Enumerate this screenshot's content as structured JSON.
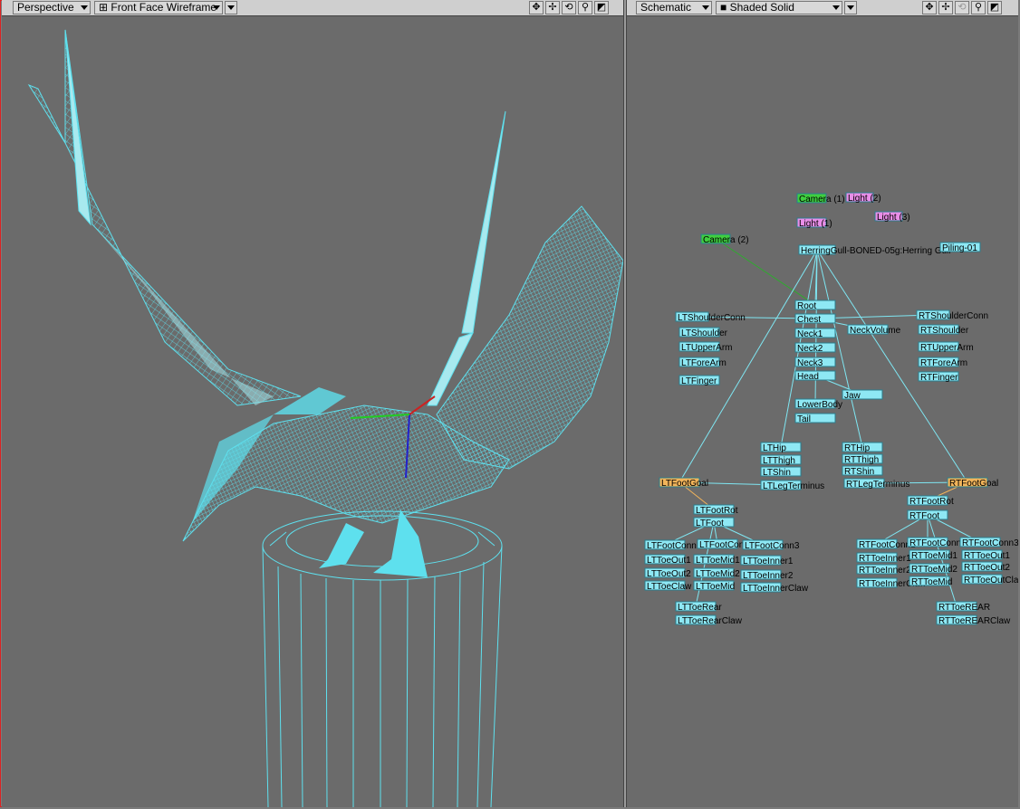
{
  "left_viewport": {
    "view_type": "Perspective",
    "render_mode": "Front Face Wireframe",
    "icons": [
      "move-view-icon",
      "rotate-view-icon",
      "zoom-view-icon",
      "maximize-view-icon"
    ]
  },
  "right_viewport": {
    "view_type": "Schematic",
    "render_mode": "Shaded Solid",
    "icons": [
      "move-view-icon",
      "rotate-view-icon",
      "zoom-view-icon",
      "maximize-view-icon"
    ]
  },
  "colors": {
    "wireframe": "#5ee0ee",
    "bone_node": "#8ee8f4",
    "camera_node": "#3fcf3f",
    "light_node": "#e88ee8",
    "goal_node": "#f2b45a",
    "link": "#7fe6f2",
    "background": "#6b6b6b"
  },
  "schematic": {
    "cameras": [
      "Camera (1)",
      "Camera (2)"
    ],
    "lights": [
      "Light (1)",
      "Light (2)",
      "Light (3)"
    ],
    "objects": [
      "HerringGull-BONED-05g:Herring Gull",
      "Piling-01"
    ],
    "bones_center": [
      "Root",
      "Chest",
      "Neck1",
      "Neck2",
      "Neck3",
      "Head",
      "Jaw",
      "NeckVolume",
      "LowerBody",
      "Tail"
    ],
    "bones_left": [
      "LTShoulderConn",
      "LTShoulder",
      "LTUpperArm",
      "LTForeArm",
      "LTFinger",
      "LTHip",
      "LTThigh",
      "LTShin",
      "LTLegTerminus",
      "LTFootGoal",
      "LTFootRot",
      "LTFoot",
      "LTFootConn1",
      "LTFootConn2",
      "LTFootConn3",
      "LTToeOut1",
      "LTToeOut2",
      "LTToeClaw",
      "LTToeMid1",
      "LTToeMid2",
      "LTToeMid",
      "LTToeInner1",
      "LTToeInner2",
      "LTToeInnerClaw",
      "LTToeRear",
      "LTToeRearClaw"
    ],
    "bones_right": [
      "RTShoulderConn",
      "RTShoulder",
      "RTUpperArm",
      "RTForeArm",
      "RTFinger",
      "RTHip",
      "RTThigh",
      "RTShin",
      "RTLegTerminus",
      "RTFootGoal",
      "RTFootRot",
      "RTFoot",
      "RTFootConn1",
      "RTFootConn2",
      "RTFootConn3",
      "RTToeInner1",
      "RTToeInner2",
      "RTToeInnerClaw",
      "RTToeMid1",
      "RTToeMid2",
      "RTToeMid",
      "RTToeOut1",
      "RTToeOut2",
      "RTToeOutClaw",
      "RTToeREAR",
      "RTToeREARClaw"
    ]
  }
}
